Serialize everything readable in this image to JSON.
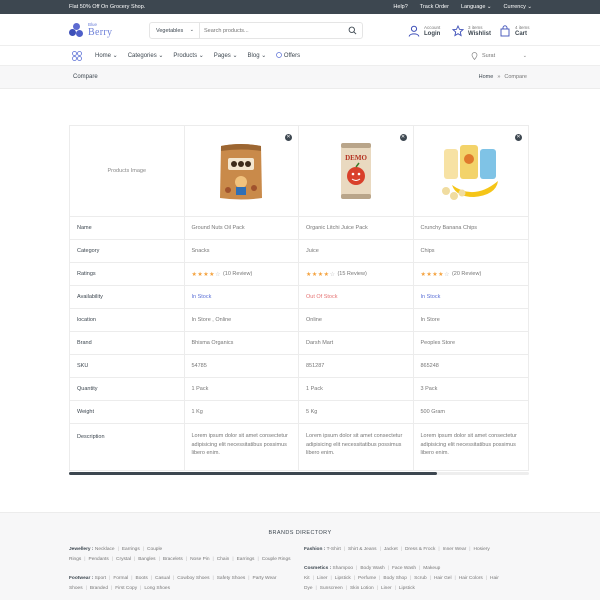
{
  "topbar": {
    "promo": "Flat 50% Off On Grocery Shop.",
    "links": [
      "Help?",
      "Track Order",
      "Language ⌄",
      "Currency ⌄"
    ]
  },
  "header": {
    "logo_small": "Blue",
    "logo_big": "Berry",
    "search_category": "Vegetables",
    "search_placeholder": "Search products...",
    "account_top": "Account",
    "account_bottom": "Login",
    "wishlist_top": "3 items",
    "wishlist_bottom": "Wishlist",
    "cart_top": "4 items",
    "cart_bottom": "Cart"
  },
  "nav": {
    "items": [
      "Home ⌄",
      "Categories ⌄",
      "Products ⌄",
      "Pages ⌄",
      "Blog ⌄",
      "Offers"
    ],
    "location": "Surat"
  },
  "breadcrumb": {
    "title": "Compare",
    "home": "Home",
    "separator": "»",
    "current": "Compare"
  },
  "compare": {
    "image_label": "Products Image",
    "products": [
      {
        "name": "Ground Nuts Oil Pack",
        "category": "Snacks",
        "rating": 4,
        "reviews": "(10 Review)",
        "availability": "In Stock",
        "available": true,
        "location": "In Store , Online",
        "brand": "Bhisma Organics",
        "sku": "54785",
        "quantity": "1 Pack",
        "weight": "1 Kg",
        "description": "Lorem ipsum dolor sit amet consectetur adipisicing elit necessitatibus possimus libero enim."
      },
      {
        "name": "Organic Litchi Juice Pack",
        "category": "Juice",
        "rating": 4,
        "reviews": "(15 Review)",
        "availability": "Out Of Stock",
        "available": false,
        "location": "Online",
        "brand": "Darsh Mart",
        "sku": "851287",
        "quantity": "1 Pack",
        "weight": "5 Kg",
        "description": "Lorem ipsum dolor sit amet consectetur adipisicing elit necessitatibus possimus libero enim."
      },
      {
        "name": "Crunchy Banana Chips",
        "category": "Chips",
        "rating": 4,
        "reviews": "(20 Review)",
        "availability": "In Stock",
        "available": true,
        "location": "In Store",
        "brand": "Peoples Store",
        "sku": "865248",
        "quantity": "3 Pack",
        "weight": "500 Gram",
        "description": "Lorem ipsum dolor sit amet consectetur adipisicing elit necessitatibus possimus libero enim."
      }
    ],
    "labels": {
      "name": "Name",
      "category": "Category",
      "ratings": "Ratings",
      "availability": "Availability",
      "location": "location",
      "brand": "Brand",
      "sku": "SKU",
      "quantity": "Quantity",
      "weight": "Weight",
      "description": "Description"
    },
    "scroll_fraction": 0.8
  },
  "brands": {
    "title": "BRANDS DIRECTORY",
    "groups": [
      {
        "label": "Jewellery :",
        "items": [
          "Necklace",
          "Earrings",
          "Couple Rings",
          "Pendants",
          "Crystal",
          "Bangles",
          "Bracelets",
          "Nose Pin",
          "Chain",
          "Earrings",
          "Couple Rings"
        ]
      },
      {
        "label": "Fashion :",
        "items": [
          "T-Shirt",
          "Shirt & Jeans",
          "Jacket",
          "Dress & Frock",
          "Inner Wear",
          "Hosiery"
        ]
      },
      {
        "label": "Footwear :",
        "items": [
          "Sport",
          "Formal",
          "Boots",
          "Casual",
          "Cowboy Shoes",
          "Safety Shoes",
          "Party Wear Shoes",
          "Branded",
          "First Copy",
          "Long Shoes"
        ]
      },
      {
        "label": "Cosmetics :",
        "items": [
          "Shampoo",
          "Body Wash",
          "Face Wash",
          "Makeup Kit",
          "Liner",
          "Lipstick",
          "Perfume",
          "Body Shop",
          "Scrub",
          "Hair Gel",
          "Hair Colors",
          "Hair Dye",
          "Sunscreen",
          "Skin Lotion",
          "Liner",
          "Lipstick"
        ]
      }
    ]
  },
  "colors": {
    "dark": "#3d4750",
    "accent": "#6c7fd8",
    "stock": "#5a6fd6",
    "out": "#e57373",
    "star": "#f4a23e"
  }
}
